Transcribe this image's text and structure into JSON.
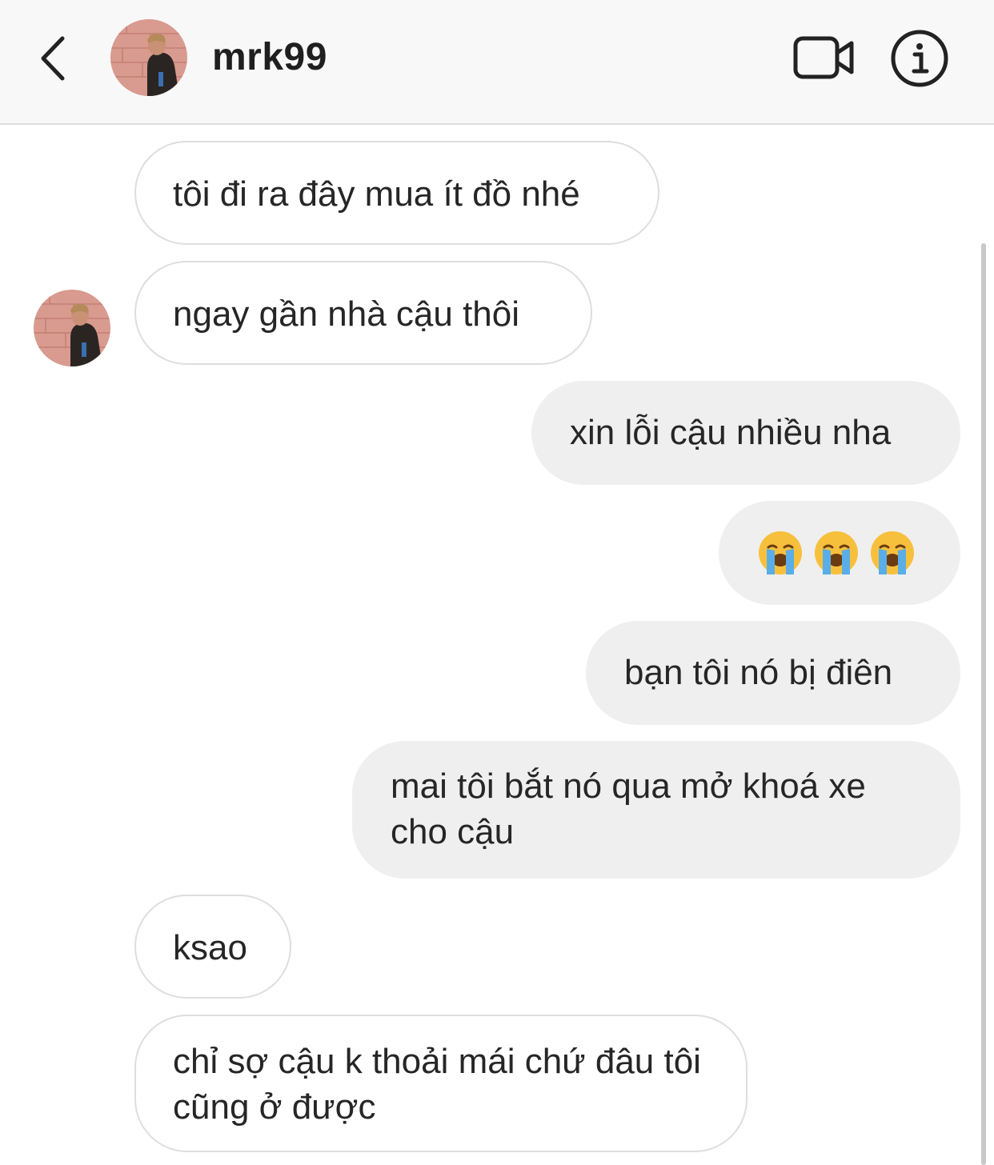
{
  "header": {
    "username": "mrk99",
    "icons": {
      "back": "chevron-left-icon",
      "video": "video-camera-icon",
      "info": "info-icon"
    }
  },
  "messages": [
    {
      "direction": "incoming",
      "text": "tôi đi ra đây mua ít đồ nhé"
    },
    {
      "direction": "incoming",
      "text": "ngay gần nhà cậu thôi",
      "show_avatar": true
    },
    {
      "direction": "outgoing",
      "text": "xin lỗi cậu nhiều nha"
    },
    {
      "direction": "outgoing",
      "emoji": "😭😭😭"
    },
    {
      "direction": "outgoing",
      "text": "bạn tôi nó bị điên"
    },
    {
      "direction": "outgoing",
      "text": "mai tôi bắt nó qua mở khoá xe cho cậu"
    },
    {
      "direction": "incoming",
      "text": "ksao"
    },
    {
      "direction": "incoming",
      "text": "chỉ sợ cậu k thoải mái chứ đâu tôi cũng ở được"
    }
  ],
  "colors": {
    "header_bg": "#f8f8f8",
    "outgoing_bubble": "#efefef",
    "incoming_border": "#dedede",
    "text": "#262626"
  }
}
